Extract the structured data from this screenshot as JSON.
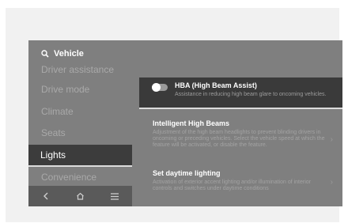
{
  "header": {
    "search_icon": "search-icon",
    "title": "Vehicle"
  },
  "sidebar": {
    "items": [
      {
        "label": "Driver assistance"
      },
      {
        "label": "Drive mode"
      },
      {
        "label": "Climate"
      },
      {
        "label": "Seats"
      },
      {
        "label": "Lights",
        "selected": true
      },
      {
        "label": "Convenience"
      }
    ]
  },
  "bottom_nav": {
    "icons": [
      "back-icon",
      "home-icon",
      "menu-icon"
    ]
  },
  "settings": {
    "hba": {
      "title": "HBA (High Beam Assist)",
      "description": "Assistance in reducing high beam glare to oncoming vehicles.",
      "enabled": false
    },
    "intelligent_high_beams": {
      "title": "Intelligent High Beams",
      "description": "Adjustment of the high beam headlights to prevent blinding drivers in oncoming or preceding vehicles. Select the vehicle speed at which the feature will be activated, or disable the feature."
    },
    "daytime_lighting": {
      "title": "Set daytime lighting",
      "description": "Activation of exterior accent lighting and/or illumination of interior controls and switches under daytime conditions"
    }
  },
  "colors": {
    "screen_bg": "#7f7f7f",
    "selected_bg": "#3c3c3c",
    "highlight_line": "#dcdcdc"
  }
}
